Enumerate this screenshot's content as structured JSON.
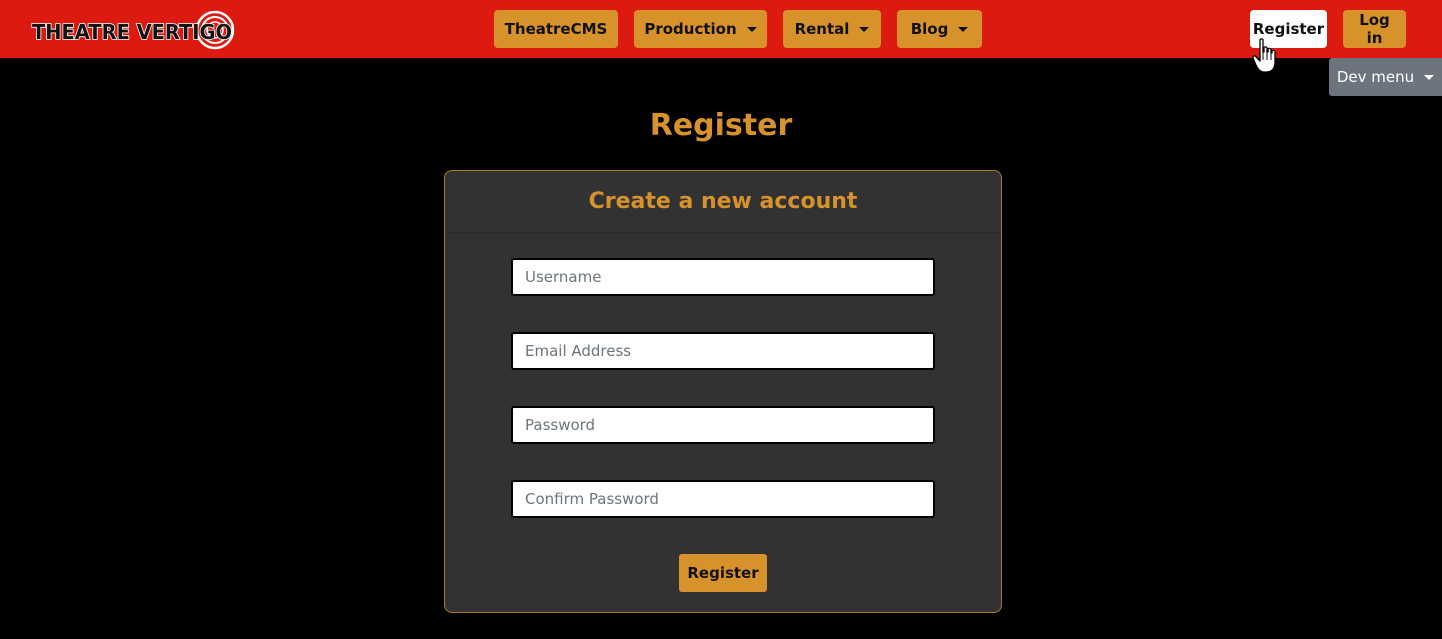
{
  "brand": {
    "logo_text": "THEATRE VERTIGO"
  },
  "nav": {
    "home_label": "TheatreCMS",
    "production_label": "Production",
    "rental_label": "Rental",
    "blog_label": "Blog",
    "register_label": "Register",
    "login_label": "Log in",
    "dev_menu_label": "Dev menu"
  },
  "page": {
    "title": "Register"
  },
  "form": {
    "header": "Create a new account",
    "username_placeholder": "Username",
    "email_placeholder": "Email Address",
    "password_placeholder": "Password",
    "confirm_password_placeholder": "Confirm Password",
    "submit_label": "Register"
  },
  "colors": {
    "navbar": "#dc1a10",
    "accent": "#d8922b",
    "card": "#323232",
    "dev_menu": "#6c757d"
  },
  "icons": {
    "cursor": "hand-pointer-icon"
  }
}
